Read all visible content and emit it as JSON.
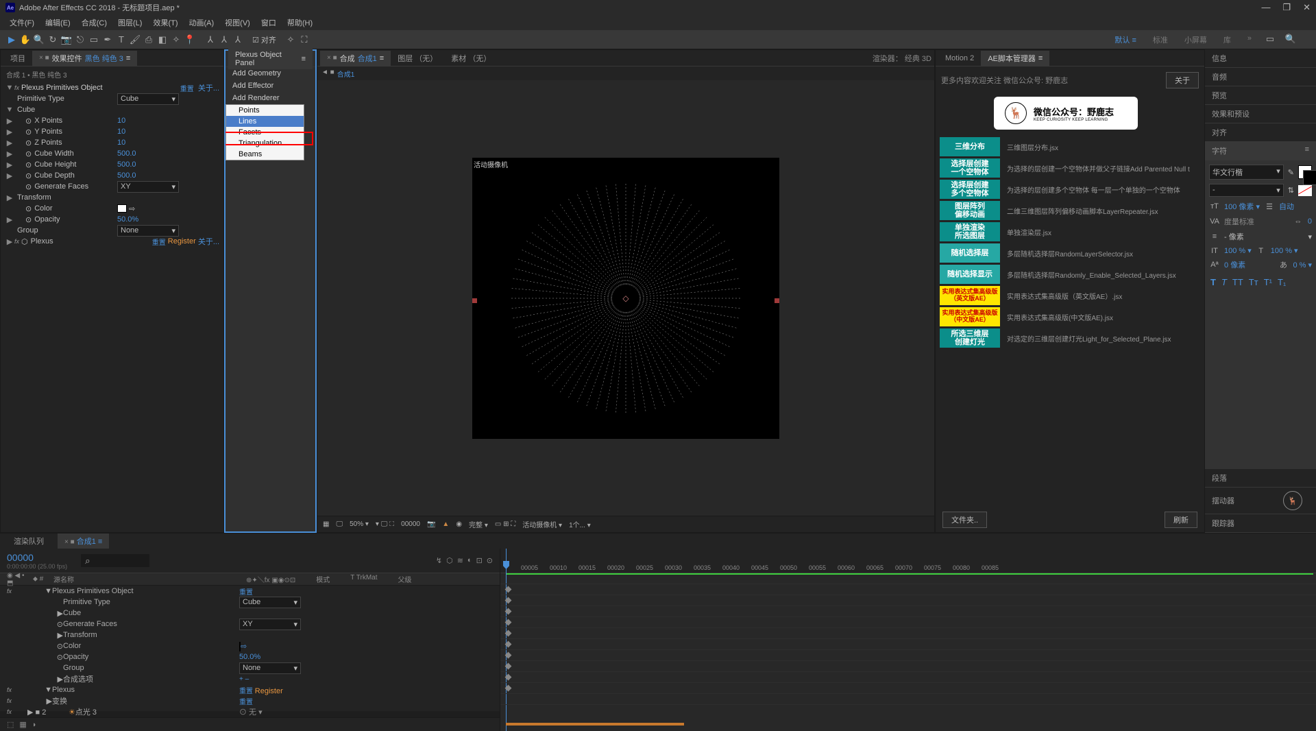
{
  "title": "Adobe After Effects CC 2018 - 无标题项目.aep *",
  "menu": {
    "file": "文件(F)",
    "edit": "编辑(E)",
    "comp": "合成(C)",
    "layer": "图层(L)",
    "effect": "效果(T)",
    "anim": "动画(A)",
    "view": "视图(V)",
    "window": "窗口",
    "help": "帮助(H)"
  },
  "workspaces": {
    "default": "默认 ≡",
    "standard": "标准",
    "small": "小屏幕",
    "library": "库"
  },
  "tabs": {
    "project": "项目",
    "ec": "效果控件",
    "ec_layer": "黑色 纯色 3",
    "ec_path": "合成 1 • 黑色 纯色 3"
  },
  "plexus_obj": {
    "name": "Plexus Primitives Object",
    "primtype": "Primitive Type",
    "primtype_val": "Cube",
    "cube": "Cube",
    "xp": "X Points",
    "xp_v": "10",
    "yp": "Y Points",
    "yp_v": "10",
    "zp": "Z Points",
    "zp_v": "10",
    "cw": "Cube Width",
    "cw_v": "500.0",
    "ch": "Cube Height",
    "ch_v": "500.0",
    "cd": "Cube Depth",
    "cd_v": "500.0",
    "gf": "Generate Faces",
    "gf_v": "XY",
    "transform": "Transform",
    "color": "Color",
    "opacity": "Opacity",
    "opacity_v": "50.0%",
    "group": "Group",
    "group_v": "None",
    "plexus": "Plexus",
    "reset": "重置",
    "register": "Register",
    "about": "关于..."
  },
  "plexus_panel": {
    "title": "Plexus Object Panel",
    "geom": "Add Geometry",
    "effector": "Add Effector",
    "renderer": "Add Renderer",
    "dd": {
      "points": "Points",
      "lines": "Lines",
      "facets": "Facets",
      "tri": "Triangulation",
      "beams": "Beams"
    }
  },
  "comp": {
    "tab": "合成",
    "name": "合成1",
    "layer_tab": "图层 （无）",
    "footage_tab": "素材 （无）",
    "renderer_lbl": "渲染器：",
    "renderer_val": "经典 3D",
    "cam_label": "活动摄像机",
    "zoom": "50%",
    "time": "00000",
    "full": "完整",
    "view": "活动摄像机",
    "views": "1个..."
  },
  "scripts_panel": {
    "motion": "Motion 2",
    "mgr": "AE脚本管理器",
    "welcome": "更多内容欢迎关注 微信公众号: 野鹿志",
    "about": "关于",
    "logo_cn": "微信公众号：野鹿志",
    "logo_en": "KEEP CURIOSITY KEEP LEARNING",
    "rows": [
      {
        "btn": "三维分布",
        "cls": "teal",
        "desc": "三维图层分布.jsx"
      },
      {
        "btn": "选择层创建\n一个空物体",
        "cls": "teal",
        "desc": "为选择的层创建一个空物体并做父子链接Add Parented Null t"
      },
      {
        "btn": "选择层创建\n多个空物体",
        "cls": "teal",
        "desc": "为选择的层创建多个空物体 每一层一个单独的一个空物体"
      },
      {
        "btn": "图层阵列\n偏移动画",
        "cls": "teal",
        "desc": "二维三维图层阵列偏移动画脚本LayerRepeater.jsx"
      },
      {
        "btn": "单独渲染\n所选图层",
        "cls": "teal",
        "desc": "单独渲染层.jsx"
      },
      {
        "btn": "随机选择层",
        "cls": "tealb",
        "desc": "多层随机选择层RandomLayerSelector.jsx"
      },
      {
        "btn": "随机选择显示",
        "cls": "tealb",
        "desc": "多层随机选择层Randomly_Enable_Selected_Layers.jsx"
      },
      {
        "btn": "实用表达式集高级版\n（英文版AE）",
        "cls": "yellow",
        "desc": "实用表达式集高级版（英文版AE）.jsx"
      },
      {
        "btn": "实用表达式集高级版\n（中文版AE）",
        "cls": "yellow",
        "desc": "实用表达式集高级版(中文版AE).jsx"
      },
      {
        "btn": "所选三维层\n创建灯光",
        "cls": "teal",
        "desc": "对选定的三维层创建灯光Light_for_Selected_Plane.jsx"
      }
    ],
    "folder": "文件夹..",
    "refresh": "刷新"
  },
  "right": {
    "info": "信息",
    "audio": "音频",
    "preview": "预览",
    "ep": "效果和预设",
    "align": "对齐",
    "char": "字符",
    "para": "段落",
    "wiggler": "摆动器",
    "tracker": "跟踪器",
    "font": "华文行楷",
    "size": "100",
    "size_u": "像素",
    "lead": "自动",
    "kern": "度量标准",
    "track": "0",
    "stroke": "- 像素",
    "scale": "100",
    "pct": "%",
    "baseline": "0",
    "bl_u": "像素"
  },
  "timeline": {
    "render_q": "渲染队列",
    "comp": "合成1",
    "timecode": "00000",
    "fps": "0:00:00:00 (25.00 fps)",
    "col_src": "源名称",
    "col_mode": "模式",
    "col_trk": "T  TrkMat",
    "col_parent": "父级",
    "rows": [
      {
        "label": "Plexus Primitives Object",
        "val": "重置",
        "ind": 1
      },
      {
        "label": "Primitive Type",
        "val": "Cube",
        "ind": 2,
        "dd": true
      },
      {
        "label": "Cube",
        "ind": 2,
        "tw": "▶"
      },
      {
        "label": "Generate Faces",
        "val": "XY",
        "ind": 2,
        "dd": true,
        "stop": true
      },
      {
        "label": "Transform",
        "ind": 2,
        "tw": "▶"
      },
      {
        "label": "Color",
        "val": "swatch",
        "ind": 2,
        "stop": true
      },
      {
        "label": "Opacity",
        "val": "50.0%",
        "ind": 2,
        "stop": true
      },
      {
        "label": "Group",
        "val": "None",
        "ind": 2,
        "dd": true
      },
      {
        "label": "合成选项",
        "val": "+ –",
        "ind": 2,
        "tw": "▶"
      },
      {
        "label": "Plexus",
        "val": "重置  Register",
        "ind": 1
      },
      {
        "label": "变换",
        "val": "重置",
        "ind": 1,
        "tw": "▶"
      },
      {
        "label": "点光 3",
        "val": "无",
        "ind": 0,
        "num": "2",
        "light": true
      }
    ],
    "ticks": [
      "00005",
      "00010",
      "00015",
      "00020",
      "00025",
      "00030",
      "00035",
      "00040",
      "00045",
      "00050",
      "00055",
      "00060",
      "00065",
      "00070",
      "00075",
      "00080",
      "00085"
    ]
  }
}
